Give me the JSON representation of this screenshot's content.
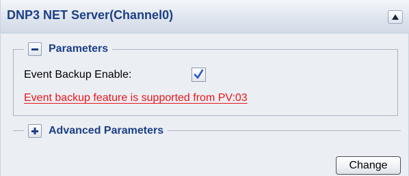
{
  "panel": {
    "title": "DNP3 NET Server(Channel0)"
  },
  "parameters": {
    "section_label": "Parameters",
    "event_backup_label": "Event Backup Enable:",
    "event_backup_checked": true,
    "warning_text": "Event backup feature is supported from PV:03"
  },
  "advanced": {
    "section_label": "Advanced Parameters"
  },
  "actions": {
    "change_label": "Change"
  },
  "icons": {
    "collapse": "collapse-up-icon",
    "parameters_toggle": "minus-icon",
    "advanced_toggle": "plus-icon",
    "checkbox_mark": "checkmark-icon"
  },
  "colors": {
    "title": "#1c3f86",
    "warning": "#e8161b",
    "panel_bg": "#ebeef3"
  }
}
